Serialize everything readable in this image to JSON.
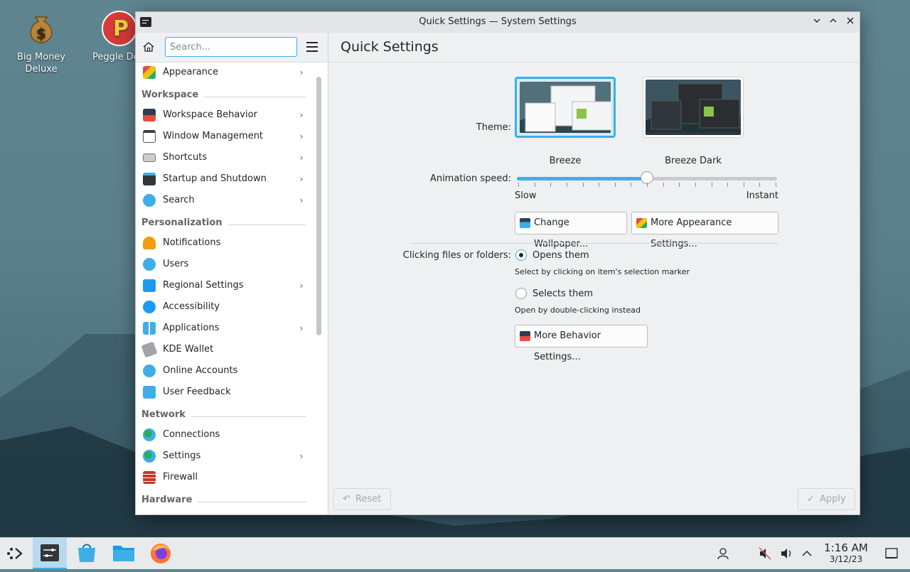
{
  "desktop": {
    "icons": [
      {
        "label_line1": "Big Money",
        "label_line2": "Deluxe"
      },
      {
        "label_line1": "Peggle De",
        "label_line2": ""
      }
    ]
  },
  "window": {
    "title": "Quick Settings — System Settings",
    "controls": {
      "minimize": "⌄",
      "maximize": "⌃",
      "close": "✕"
    }
  },
  "sidebar": {
    "search_placeholder": "Search...",
    "top_item": {
      "label": "Appearance",
      "icon": "appearance-icon",
      "chevron": "›"
    },
    "categories": [
      {
        "title": "Workspace",
        "items": [
          {
            "label": "Workspace Behavior",
            "icon": "workspace-behavior-icon",
            "chevron": "›"
          },
          {
            "label": "Window Management",
            "icon": "window-management-icon",
            "chevron": "›"
          },
          {
            "label": "Shortcuts",
            "icon": "keyboard-icon",
            "chevron": "›"
          },
          {
            "label": "Startup and Shutdown",
            "icon": "startup-icon",
            "chevron": "›"
          },
          {
            "label": "Search",
            "icon": "search-icon",
            "chevron": "›"
          }
        ]
      },
      {
        "title": "Personalization",
        "items": [
          {
            "label": "Notifications",
            "icon": "bell-icon",
            "chevron": ""
          },
          {
            "label": "Users",
            "icon": "users-icon",
            "chevron": ""
          },
          {
            "label": "Regional Settings",
            "icon": "regional-icon",
            "chevron": "›"
          },
          {
            "label": "Accessibility",
            "icon": "accessibility-icon",
            "chevron": ""
          },
          {
            "label": "Applications",
            "icon": "applications-icon",
            "chevron": "›"
          },
          {
            "label": "KDE Wallet",
            "icon": "wallet-icon",
            "chevron": ""
          },
          {
            "label": "Online Accounts",
            "icon": "online-accounts-icon",
            "chevron": ""
          },
          {
            "label": "User Feedback",
            "icon": "feedback-icon",
            "chevron": ""
          }
        ]
      },
      {
        "title": "Network",
        "items": [
          {
            "label": "Connections",
            "icon": "globe-icon",
            "chevron": ""
          },
          {
            "label": "Settings",
            "icon": "globe-icon",
            "chevron": "›"
          },
          {
            "label": "Firewall",
            "icon": "firewall-icon",
            "chevron": ""
          }
        ]
      },
      {
        "title": "Hardware",
        "items": []
      }
    ]
  },
  "main": {
    "title": "Quick Settings",
    "theme_label": "Theme:",
    "themes": [
      {
        "name": "Breeze",
        "selected": true
      },
      {
        "name": "Breeze Dark",
        "selected": false
      }
    ],
    "animation_label": "Animation speed:",
    "animation_value_fraction": 0.5,
    "slider_min_label": "Slow",
    "slider_max_label": "Instant",
    "change_wallpaper": "Change Wallpaper...",
    "more_appearance": "More Appearance Settings...",
    "clicking_label": "Clicking files or folders:",
    "option_open": "Opens them",
    "option_open_hint": "Select by clicking on item's selection marker",
    "option_select": "Selects them",
    "option_select_hint": "Open by double-clicking instead",
    "selected_option": "Opens them",
    "more_behavior": "More Behavior Settings...",
    "reset": "Reset",
    "apply": "Apply"
  },
  "taskbar": {
    "apps": [
      "application-launcher-icon",
      "system-settings-icon",
      "discover-icon",
      "dolphin-icon",
      "firefox-icon"
    ],
    "tray": [
      "user-icon",
      "audio-muted-icon",
      "volume-icon",
      "expand-tray-icon",
      "show-desktop-icon"
    ],
    "time": "1:16 AM",
    "date": "3/12/23"
  },
  "colors": {
    "accent": "#3daee9",
    "window_bg": "#eff0f1",
    "text": "#232629"
  }
}
